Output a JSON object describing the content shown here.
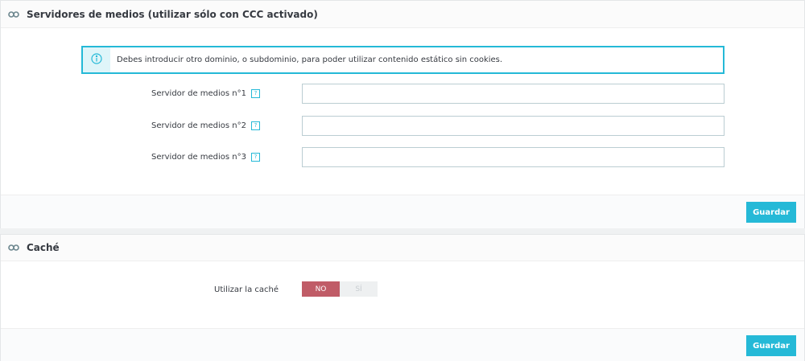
{
  "media_panel": {
    "title": "Servidores de medios (utilizar sólo con CCC activado)",
    "heading_icon": "link-icon",
    "alert": {
      "icon": "info-icon",
      "text": "Debes introducir otro dominio, o subdominio, para poder utilizar contenido estático sin cookies."
    },
    "fields": [
      {
        "label": "Servidor de medios n°1",
        "help": "?",
        "value": ""
      },
      {
        "label": "Servidor de medios n°2",
        "help": "?",
        "value": ""
      },
      {
        "label": "Servidor de medios n°3",
        "help": "?",
        "value": ""
      }
    ],
    "save_label": "Guardar"
  },
  "cache_panel": {
    "title": "Caché",
    "heading_icon": "link-icon",
    "switch": {
      "label": "Utilizar la caché",
      "no_label": "NO",
      "yes_label": "SÍ",
      "selected": "NO"
    },
    "save_label": "Guardar"
  },
  "colors": {
    "accent": "#25b9d7",
    "switch_off_active": "#c05c67",
    "alert_bg": "#dff5f9"
  }
}
